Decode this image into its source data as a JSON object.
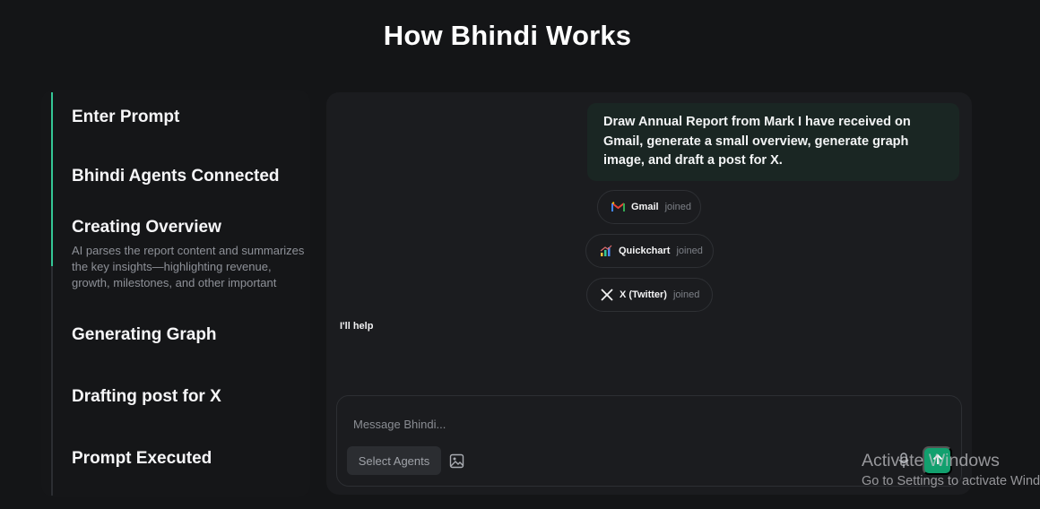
{
  "page": {
    "title": "How Bhindi Works"
  },
  "steps": [
    {
      "title": "Enter Prompt",
      "description": ""
    },
    {
      "title": "Bhindi Agents Connected",
      "description": ""
    },
    {
      "title": "Creating Overview",
      "description": "AI parses the report content and summarizes the key insights—highlighting revenue, growth, milestones, and other important metrics."
    },
    {
      "title": "Generating Graph",
      "description": ""
    },
    {
      "title": "Drafting post for X",
      "description": ""
    },
    {
      "title": "Prompt Executed",
      "description": ""
    }
  ],
  "progress": {
    "completed_fraction": 0.43,
    "accent_color": "#34c796"
  },
  "chat": {
    "user_message": "Draw Annual Report from Mark I have received on Gmail, generate a small overview, generate graph image, and draft a post for X.",
    "agents": [
      {
        "name": "Gmail",
        "status": "joined",
        "icon": "gmail-icon"
      },
      {
        "name": "Quickchart",
        "status": "joined",
        "icon": "quickchart-icon"
      },
      {
        "name": "X (Twitter)",
        "status": "joined",
        "icon": "x-icon"
      }
    ],
    "assistant_message": "I'll help"
  },
  "composer": {
    "placeholder": "Message Bhindi...",
    "select_agents_label": "Select Agents",
    "image_icon": "image-icon",
    "mic_icon": "mic-icon",
    "send_icon": "send-icon",
    "send_color": "#12a06e"
  },
  "watermark": {
    "line1": "Activate Windows",
    "line2": "Go to Settings to activate Windows."
  }
}
